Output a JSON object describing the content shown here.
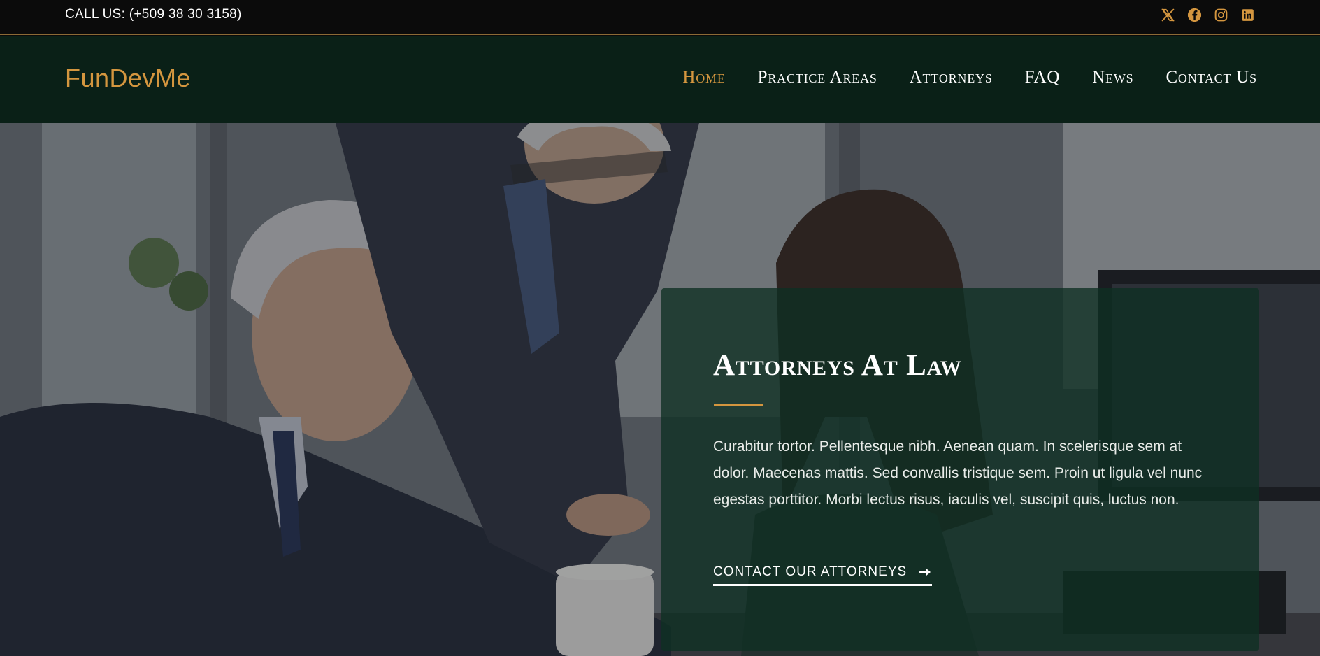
{
  "topbar": {
    "call_text": "CALL US: (+509 38 30 3158)",
    "socials": [
      {
        "icon": "x-twitter-icon"
      },
      {
        "icon": "facebook-icon"
      },
      {
        "icon": "instagram-icon"
      },
      {
        "icon": "linkedin-icon"
      }
    ],
    "accent": "#d4963f"
  },
  "header": {
    "logo": "FunDevMe",
    "nav": [
      {
        "label": "Home",
        "active": true
      },
      {
        "label": "Practice Areas",
        "active": false
      },
      {
        "label": "Attorneys",
        "active": false
      },
      {
        "label": "FAQ",
        "active": false
      },
      {
        "label": "News",
        "active": false
      },
      {
        "label": "Contact Us",
        "active": false
      }
    ],
    "background": "#0a2017"
  },
  "hero": {
    "title": "Attorneys At Law",
    "body": "Curabitur tortor. Pellentesque nibh. Aenean quam. In scelerisque sem at dolor. Maecenas mattis. Sed convallis tristique sem. Proin ut ligula vel nunc egestas porttitor. Morbi lectus risus, iaculis vel, suscipit quis, luctus non.",
    "cta_label": "CONTACT OUR ATTORNEYS",
    "cta_icon": "arrow-right-icon"
  }
}
